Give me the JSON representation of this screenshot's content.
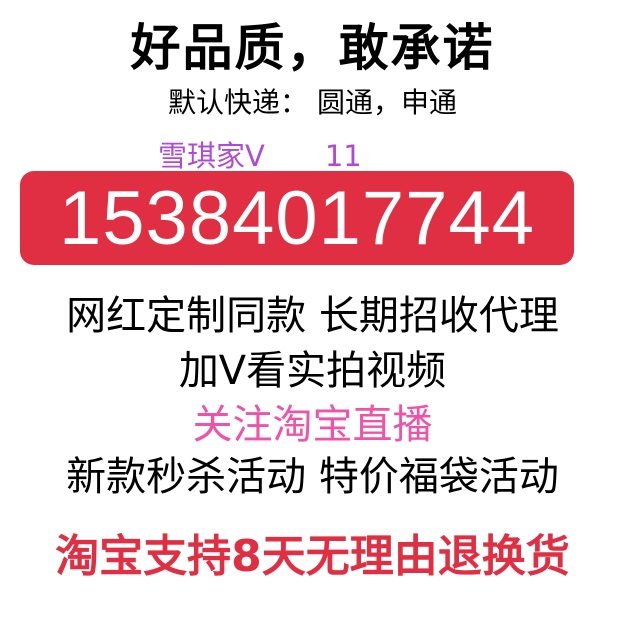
{
  "headline": "好品质，敢承诺",
  "courier": "默认快递： 圆通，申通",
  "wechat": {
    "label": "雪琪家V",
    "number": "11"
  },
  "phone": "15384017744",
  "lines": [
    "网红定制同款 长期招收代理",
    "加V看实拍视频",
    "关注淘宝直播",
    "新款秒杀活动 特价福袋活动"
  ],
  "return_policy": "淘宝支持8天无理由退换货",
  "colors": {
    "red": "#e02f43",
    "pink": "#f053a6",
    "purple": "#b04ad6"
  }
}
